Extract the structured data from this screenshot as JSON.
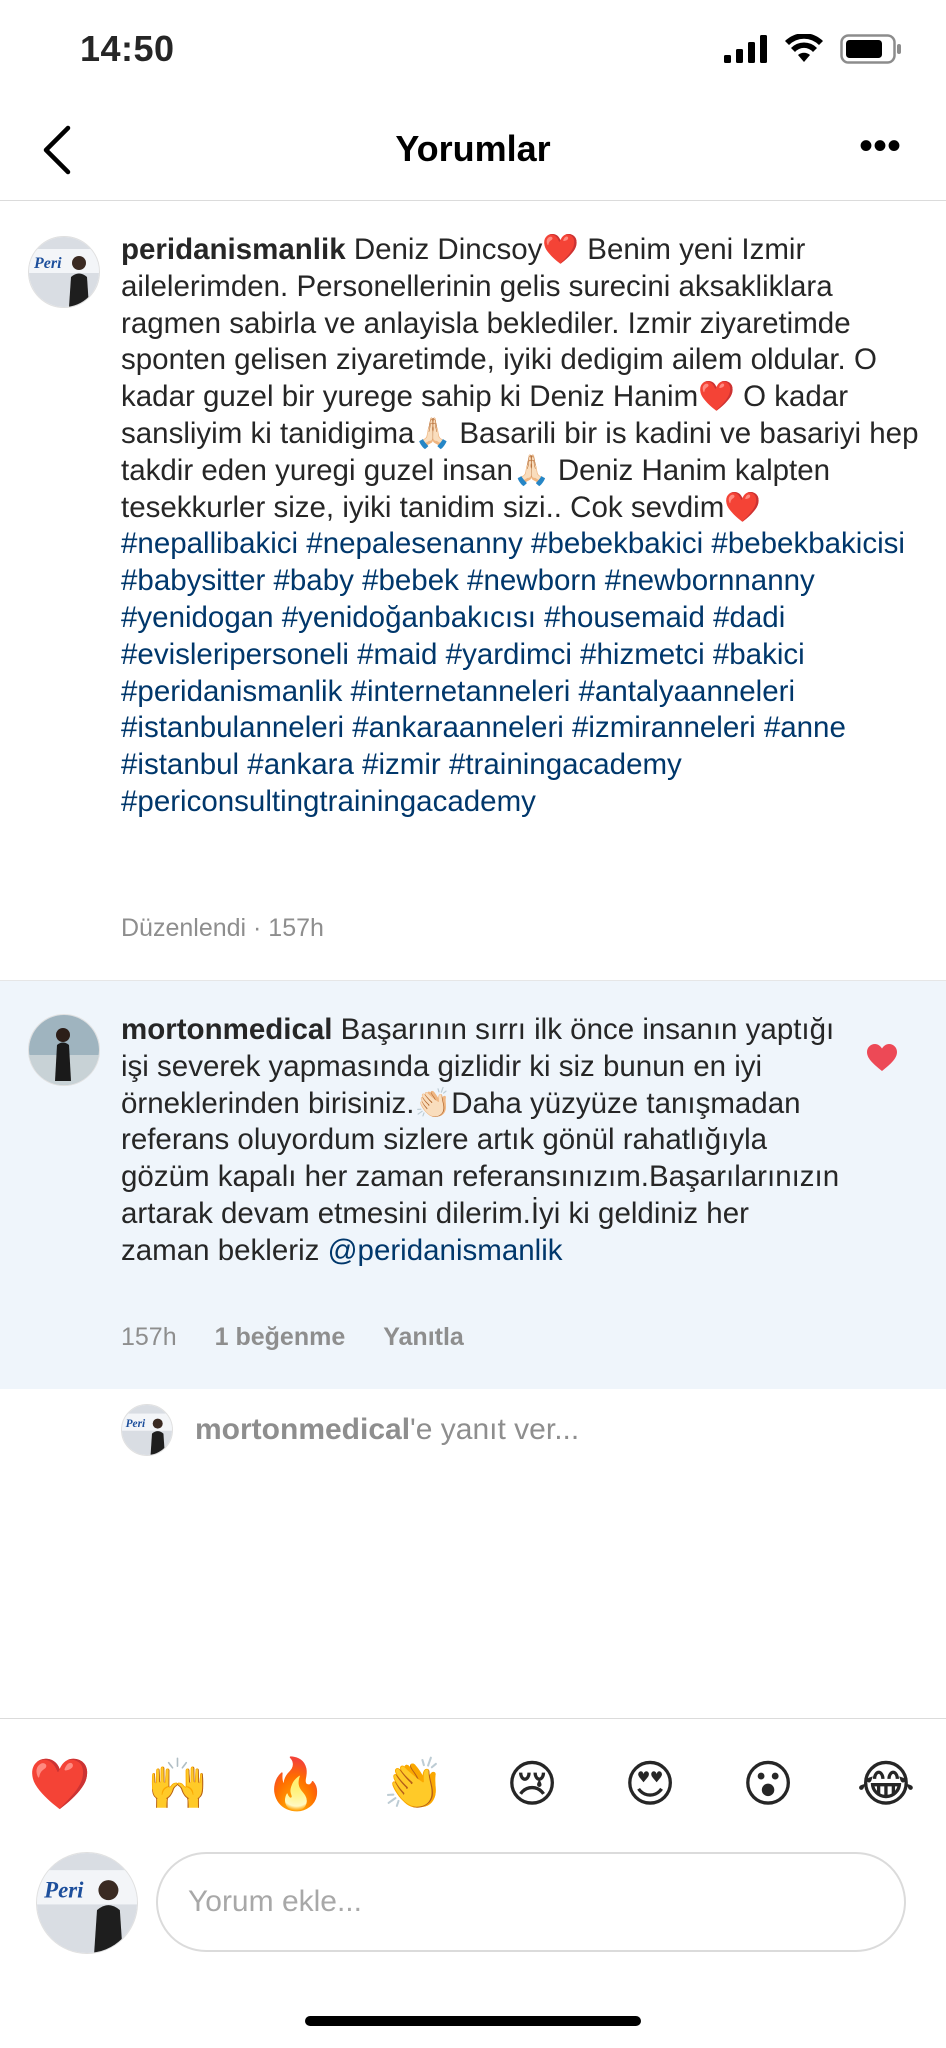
{
  "status": {
    "time": "14:50"
  },
  "header": {
    "title": "Yorumlar",
    "more": "•••"
  },
  "caption": {
    "username": "peridanismanlik",
    "body_pre": "Deniz Dincsoy❤️ Benim yeni Izmir ailelerimden. Personellerinin gelis surecini aksakliklara ragmen sabirla ve anlayisla beklediler. Izmir ziyaretimde sponten gelisen ziyaretimde, iyiki dedigim ailem oldular. O kadar guzel bir yurege sahip ki Deniz Hanim❤️ O kadar sansliyim ki tanidigima🙏🏻 Basarili bir is kadini ve basariyi hep takdir eden yuregi guzel insan🙏🏻 Deniz Hanim kalpten tesekkurler size, iyiki tanidim sizi.. Cok sevdim❤️ ",
    "hashtags": "#nepallibakici #nepalesenanny #bebekbakici #bebekbakicisi #babysitter #baby #bebek #newborn #newbornnanny #yenidogan #yenidoğanbakıcısı #housemaid #dadi #evisleripersoneli #maid #yardimci #hizmetci #bakici #peridanismanlik #internetanneleri #antalyaanneleri #istanbulanneleri #ankaraanneleri #izmiranneleri #anne #istanbul #ankara #izmir #trainingacademy #periconsultingtrainingacademy",
    "meta": "Düzenlendi · 157h"
  },
  "comment": {
    "username": "mortonmedical",
    "body": "Başarının sırrı ilk önce insanın yaptığı işi severek yapmasında gizlidir ki siz bunun en iyi örneklerinden birisiniz.👏🏻Daha yüzyüze tanışmadan referans oluyordum sizlere artık gönül rahatlığıyla gözüm kapalı her zaman referansınızım.Başarılarınızın artarak devam etmesini dilerim.İyi ki geldiniz her zaman bekleriz ",
    "mention": "@peridanismanlik",
    "time": "157h",
    "likes": "1 beğenme",
    "reply": "Yanıtla",
    "liked": true
  },
  "reply_prompt": {
    "username": "mortonmedical",
    "suffix": "'e yanıt ver..."
  },
  "reactions": [
    "❤️",
    "🙌",
    "🔥",
    "👏",
    "😢",
    "😍",
    "😮",
    "😂"
  ],
  "composer": {
    "placeholder": "Yorum ekle..."
  },
  "colors": {
    "hashtag": "#00376b",
    "heart": "#ed4956",
    "comment_bg": "#eff5fb"
  }
}
